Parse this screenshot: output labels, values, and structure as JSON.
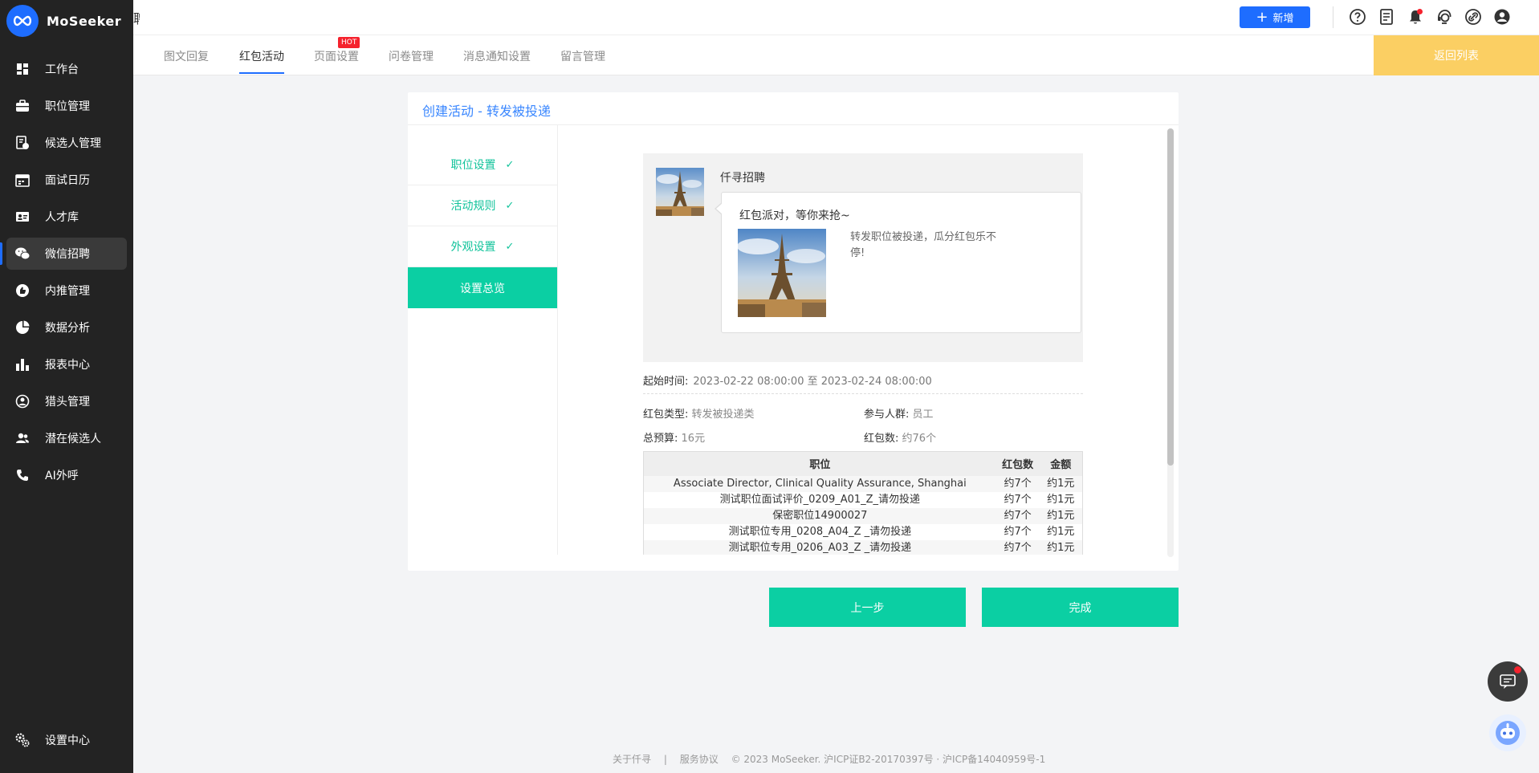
{
  "brand": {
    "name": "MoSeeker",
    "logo_icon": "infinity-logo-icon",
    "accent": "#1e6dff"
  },
  "sidebar": {
    "items": [
      {
        "label": "工作台",
        "icon": "dashboard-icon"
      },
      {
        "label": "职位管理",
        "icon": "briefcase-icon"
      },
      {
        "label": "候选人管理",
        "icon": "candidate-doc-icon"
      },
      {
        "label": "面试日历",
        "icon": "calendar-icon"
      },
      {
        "label": "人才库",
        "icon": "id-card-icon"
      },
      {
        "label": "微信招聘",
        "icon": "wechat-icon",
        "active": true
      },
      {
        "label": "内推管理",
        "icon": "thumbs-up-icon"
      },
      {
        "label": "数据分析",
        "icon": "pie-chart-icon"
      },
      {
        "label": "报表中心",
        "icon": "bar-chart-icon"
      },
      {
        "label": "猎头管理",
        "icon": "headhunter-icon"
      },
      {
        "label": "潜在候选人",
        "icon": "people-icon"
      },
      {
        "label": "AI外呼",
        "icon": "phone-icon"
      }
    ],
    "bottom": {
      "label": "设置中心",
      "icon": "settings-gears-icon"
    }
  },
  "topbar": {
    "title_fragment": "聘",
    "new_label": "新增",
    "icons": [
      "help-icon",
      "document-icon",
      "bell-icon",
      "support-icon",
      "link-icon",
      "user-icon"
    ]
  },
  "tabs": [
    {
      "label": "图文回复"
    },
    {
      "label": "红包活动",
      "active": true
    },
    {
      "label": "页面设置",
      "badge": "HOT"
    },
    {
      "label": "问卷管理"
    },
    {
      "label": "消息通知设置"
    },
    {
      "label": "留言管理"
    }
  ],
  "back_to_list": "返回列表",
  "card": {
    "title": "创建活动 - 转发被投递",
    "steps": [
      {
        "label": "职位设置",
        "done": true
      },
      {
        "label": "活动规则",
        "done": true
      },
      {
        "label": "外观设置",
        "done": true
      },
      {
        "label": "设置总览",
        "current": true
      }
    ],
    "check_mark": "✓",
    "preview": {
      "sender": "仟寻招聘",
      "bubble_title": "红包派对，等你来抢~",
      "bubble_desc": "转发职位被投递，瓜分红包乐不停!"
    },
    "time": {
      "label": "起始时间:",
      "value": "2023-02-22 08:00:00 至 2023-02-24 08:00:00"
    },
    "info": {
      "type_label": "红包类型:",
      "type_value": "转发被投递类",
      "crowd_label": "参与人群:",
      "crowd_value": "员工",
      "budget_label": "总预算:",
      "budget_value": "16元",
      "count_label": "红包数:",
      "count_value": "约76个"
    },
    "table": {
      "headers": [
        "职位",
        "红包数",
        "金额"
      ],
      "rows": [
        [
          "Associate Director, Clinical Quality Assurance, Shanghai",
          "约7个",
          "约1元"
        ],
        [
          "测试职位面试评价_0209_A01_Z_请勿投递",
          "约7个",
          "约1元"
        ],
        [
          "保密职位14900027",
          "约7个",
          "约1元"
        ],
        [
          "测试职位专用_0208_A04_Z _请勿投递",
          "约7个",
          "约1元"
        ],
        [
          "测试职位专用_0206_A03_Z _请勿投递",
          "约7个",
          "约1元"
        ]
      ]
    }
  },
  "buttons": {
    "prev": "上一步",
    "done": "完成"
  },
  "footer": {
    "about": "关于仟寻",
    "sep": "|",
    "terms": "服务协议",
    "copyright": "© 2023 MoSeeker. 沪ICP证B2-20170397号 · 沪ICP备14040959号-1"
  },
  "colors": {
    "green": "#0bcfa3",
    "yellow": "#fbcf63",
    "sidebar_bg": "#232323"
  }
}
